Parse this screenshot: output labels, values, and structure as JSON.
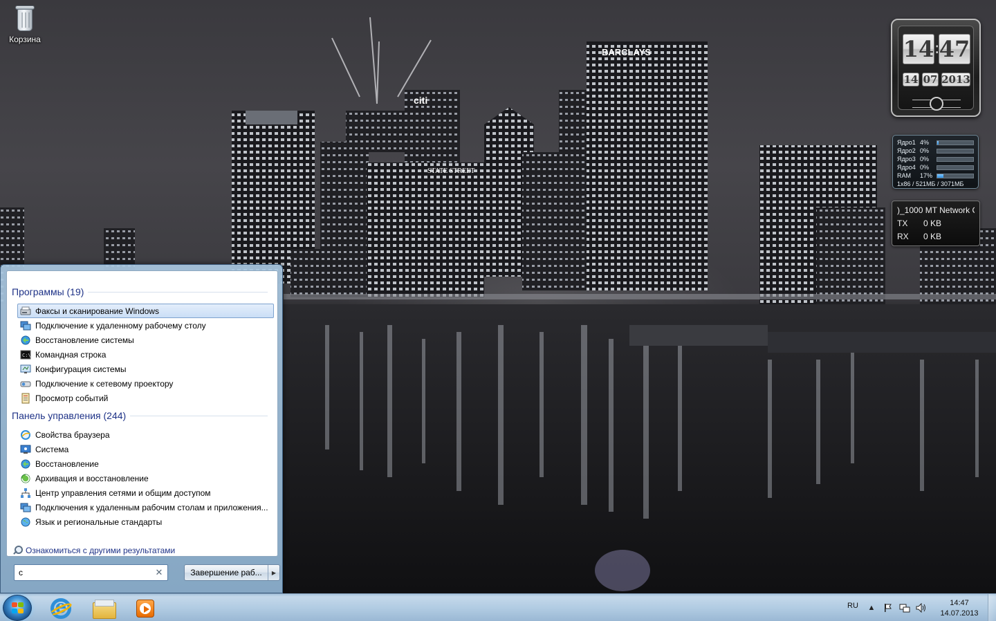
{
  "desktop": {
    "icons": [
      {
        "label": "Корзина",
        "icon": "recycle-bin-icon"
      }
    ]
  },
  "gadgets": {
    "clock": {
      "hours": "14",
      "minutes": "47",
      "day": "14",
      "month": "07",
      "year": "2013"
    },
    "cpu": {
      "rows": [
        {
          "name": "Ядро1",
          "value": "4%",
          "level": 0.04
        },
        {
          "name": "Ядро2",
          "value": "0%",
          "level": 0.0
        },
        {
          "name": "Ядро3",
          "value": "0%",
          "level": 0.0
        },
        {
          "name": "Ядро4",
          "value": "0%",
          "level": 0.0
        },
        {
          "name": "RAM",
          "value": "17%",
          "level": 0.17
        }
      ],
      "footer": "1x86 / 521МБ / 3071МБ"
    },
    "network": {
      "title": ")_1000 MT Network C",
      "tx_label": "TX",
      "tx_value": "0 KB",
      "rx_label": "RX",
      "rx_value": "0 KB"
    }
  },
  "start_menu": {
    "programs_header": "Программы (19)",
    "programs": [
      {
        "label": "Факсы и сканирование Windows",
        "icon": "fax-scanner-icon",
        "selected": true
      },
      {
        "label": "Подключение к удаленному рабочему столу",
        "icon": "remote-desktop-icon"
      },
      {
        "label": "Восстановление системы",
        "icon": "system-restore-icon"
      },
      {
        "label": "Командная строка",
        "icon": "command-prompt-icon"
      },
      {
        "label": "Конфигурация системы",
        "icon": "system-config-icon"
      },
      {
        "label": "Подключение к сетевому проектору",
        "icon": "network-projector-icon"
      },
      {
        "label": "Просмотр событий",
        "icon": "event-viewer-icon"
      }
    ],
    "control_panel_header": "Панель управления (244)",
    "control_panel": [
      {
        "label": "Свойства браузера",
        "icon": "browser-properties-icon"
      },
      {
        "label": "Система",
        "icon": "system-icon"
      },
      {
        "label": "Восстановление",
        "icon": "recovery-icon"
      },
      {
        "label": "Архивация и восстановление",
        "icon": "backup-restore-icon"
      },
      {
        "label": "Центр управления сетями и общим доступом",
        "icon": "network-center-icon"
      },
      {
        "label": "Подключения к удаленным рабочим столам и приложения...",
        "icon": "remote-apps-icon"
      },
      {
        "label": "Язык и региональные стандарты",
        "icon": "region-language-icon"
      }
    ],
    "more_results": "Ознакомиться с другими результатами",
    "search_value": "с",
    "shutdown_label": "Завершение раб..."
  },
  "taskbar": {
    "pinned": [
      {
        "name": "internet-explorer-button",
        "icon": "internet-explorer-icon"
      },
      {
        "name": "explorer-button",
        "icon": "folder-icon"
      },
      {
        "name": "media-player-button",
        "icon": "media-player-icon"
      }
    ],
    "language": "RU",
    "time": "14:47",
    "date": "14.07.2013"
  }
}
